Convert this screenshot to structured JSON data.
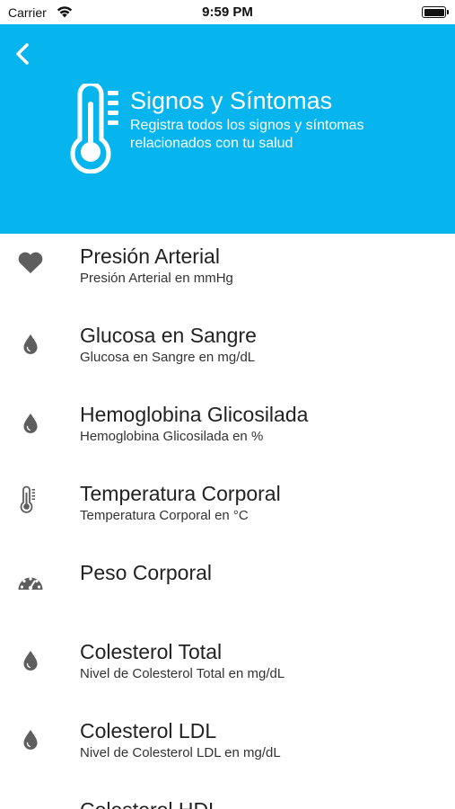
{
  "status_bar": {
    "carrier": "Carrier",
    "time": "9:59 PM"
  },
  "header": {
    "title": "Signos y Síntomas",
    "subtitle": "Registra todos los signos y síntomas relacionados con tu salud",
    "background_color": "#06b4ee",
    "icon": "thermometer-icon",
    "back_icon": "chevron-left-icon"
  },
  "list": {
    "items": [
      {
        "title": "Presión Arterial",
        "subtitle": "Presión Arterial en mmHg",
        "icon": "heart-icon"
      },
      {
        "title": "Glucosa en Sangre",
        "subtitle": "Glucosa en Sangre en mg/dL",
        "icon": "drop-icon"
      },
      {
        "title": "Hemoglobina Glicosilada",
        "subtitle": "Hemoglobina Glicosilada en %",
        "icon": "drop-icon"
      },
      {
        "title": "Temperatura Corporal",
        "subtitle": "Temperatura Corporal en °C",
        "icon": "thermometer-icon"
      },
      {
        "title": "Peso Corporal",
        "subtitle": "",
        "icon": "gauge-icon"
      },
      {
        "title": "Colesterol Total",
        "subtitle": "Nivel de Colesterol Total en mg/dL",
        "icon": "drop-icon"
      },
      {
        "title": "Colesterol LDL",
        "subtitle": "Nivel de Colesterol LDL en mg/dL",
        "icon": "drop-icon"
      },
      {
        "title": "Colesterol HDL",
        "subtitle": "",
        "icon": "drop-icon"
      }
    ]
  }
}
